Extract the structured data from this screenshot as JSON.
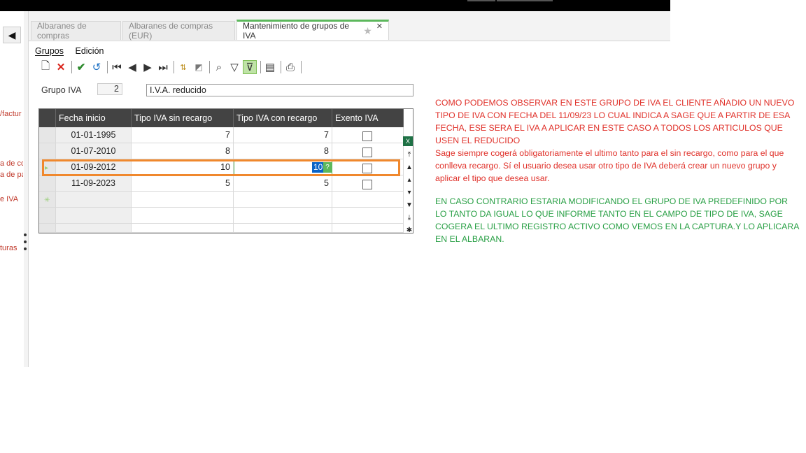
{
  "tabs": [
    {
      "label": "Albaranes de compras"
    },
    {
      "label": "Albaranes de compras (EUR)"
    },
    {
      "label": "Mantenimiento de grupos de IVA"
    }
  ],
  "menu": {
    "grupos": "Grupos",
    "edicion": "Edición"
  },
  "left_links": [
    "/factur",
    "a de co",
    "a de pa",
    "e IVA",
    "turas"
  ],
  "form": {
    "label": "Grupo IVA",
    "number": "2",
    "name": "I.V.A. reducido"
  },
  "grid": {
    "columns": [
      "Fecha inicio",
      "Tipo IVA sin recargo",
      "Tipo IVA con recargo",
      "Exento IVA"
    ],
    "rows": [
      {
        "fecha": "01-01-1995",
        "sin": "7",
        "con": "7"
      },
      {
        "fecha": "01-07-2010",
        "sin": "8",
        "con": "8"
      },
      {
        "fecha": "01-09-2012",
        "sin": "10",
        "con": "10"
      },
      {
        "fecha": "11-09-2023",
        "sin": "5",
        "con": "5"
      }
    ],
    "help_glyph": "?"
  },
  "notes": {
    "red1": "COMO PODEMOS OBSERVAR EN ESTE GRUPO DE IVA EL CLIENTE AÑADIO UN NUEVO TIPO DE IVA CON FECHA DEL 11/09/23 LO CUAL INDICA A SAGE QUE A PARTIR DE ESA FECHA, ESE SERA EL IVA A APLICAR EN ESTE CASO A TODOS LOS ARTICULOS QUE USEN EL REDUCIDO",
    "red2": "Sage siempre cogerá obligatoriamente el ultimo tanto para el sin recargo, como para el que conlleva recargo. Sí el usuario desea usar otro tipo de IVA deberá crear un nuevo grupo y aplicar el tipo que desea usar.",
    "green": "EN CASO CONTRARIO ESTARIA MODIFICANDO EL GRUPO DE IVA PREDEFINIDO POR LO TANTO DA IGUAL LO QUE INFORME TANTO EN EL CAMPO DE TIPO DE IVA, SAGE COGERA EL ULTIMO REGISTRO ACTIVO COMO VEMOS EN LA CAPTURA.Y LO APLICARA EN EL ALBARAN."
  },
  "colors": {
    "accent_green": "#5cb85c",
    "highlight_orange": "#f0882d",
    "note_red": "#e0322b",
    "note_green": "#2aa046"
  }
}
